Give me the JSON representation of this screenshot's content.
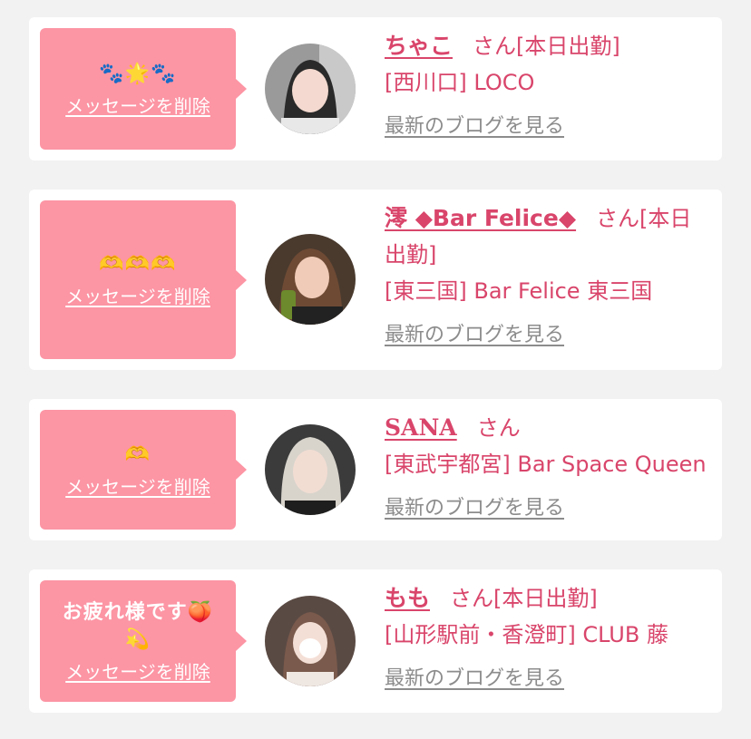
{
  "cards": [
    {
      "message": "🐾🌟🐾",
      "delete_label": "メッセージを削除",
      "name": "ちゃこ",
      "honorific": "さん[本日出勤]",
      "shop": "[西川口] LOCO",
      "blog_label": "最新のブログを見る"
    },
    {
      "message": "🫶🫶🫶",
      "delete_label": "メッセージを削除",
      "name": "澪 ◆Bar Felice◆",
      "honorific": "さん[本日出勤]",
      "shop": "[東三国] Bar Felice 東三国",
      "blog_label": "最新のブログを見る"
    },
    {
      "message": "🫶",
      "delete_label": "メッセージを削除",
      "name": "SANA",
      "honorific": "さん",
      "shop": "[東武宇都宮] Bar Space Queen",
      "blog_label": "最新のブログを見る"
    },
    {
      "message": "お疲れ様です🍑💫",
      "delete_label": "メッセージを削除",
      "name": "もも",
      "honorific": "さん[本日出勤]",
      "shop": "[山形駅前・香澄町] CLUB 藤",
      "blog_label": "最新のブログを見る"
    }
  ],
  "colors": {
    "accent": "#d9456b",
    "bubble": "#fc95a4",
    "link_gray": "#8c8c8c",
    "background": "#f2f2f2"
  }
}
